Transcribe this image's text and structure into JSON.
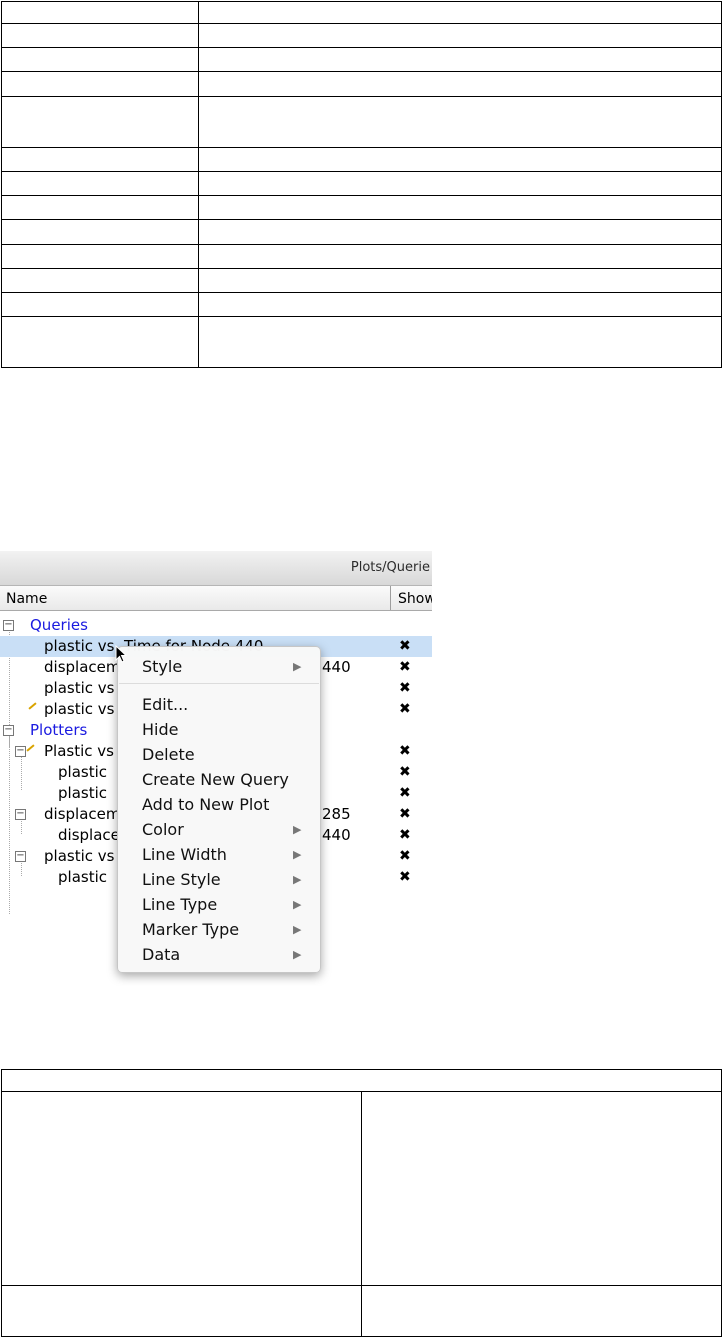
{
  "panel": {
    "title": "Plots/Querie",
    "col_name": "Name",
    "col_show": "Show",
    "tree": [
      {
        "label": "Queries",
        "kind": "group"
      },
      {
        "label": "plastic vs. Time for Node 440",
        "kind": "item",
        "selected": true
      },
      {
        "label": "displacem",
        "kind": "item",
        "suffix": "440"
      },
      {
        "label": "plastic vs",
        "kind": "item"
      },
      {
        "label": "plastic vs",
        "kind": "item",
        "pen": true
      },
      {
        "label": "Plotters",
        "kind": "group"
      },
      {
        "label": "Plastic vs",
        "kind": "subgroup",
        "pen": true
      },
      {
        "label": "plastic",
        "kind": "leaf"
      },
      {
        "label": "plastic",
        "kind": "leaf"
      },
      {
        "label": "displacem",
        "kind": "subgroup",
        "suffix": "285"
      },
      {
        "label": "displace",
        "kind": "leaf",
        "suffix": "440"
      },
      {
        "label": "plastic vs",
        "kind": "subgroup"
      },
      {
        "label": "plastic",
        "kind": "leaf"
      }
    ],
    "show_mark": "✖",
    "context_menu": [
      {
        "label": "Style",
        "submenu": true
      },
      {
        "label": "Edit...",
        "submenu": false
      },
      {
        "label": "Hide",
        "submenu": false
      },
      {
        "label": "Delete",
        "submenu": false
      },
      {
        "label": "Create New Query",
        "submenu": false
      },
      {
        "label": "Add to New Plot",
        "submenu": false
      },
      {
        "label": "Color",
        "submenu": true
      },
      {
        "label": "Line Width",
        "submenu": true
      },
      {
        "label": "Line Style",
        "submenu": true
      },
      {
        "label": "Line Type",
        "submenu": true
      },
      {
        "label": "Marker Type",
        "submenu": true
      },
      {
        "label": "Data",
        "submenu": true
      }
    ],
    "submenu_arrow": "▶",
    "collapse_glyph": "−"
  }
}
